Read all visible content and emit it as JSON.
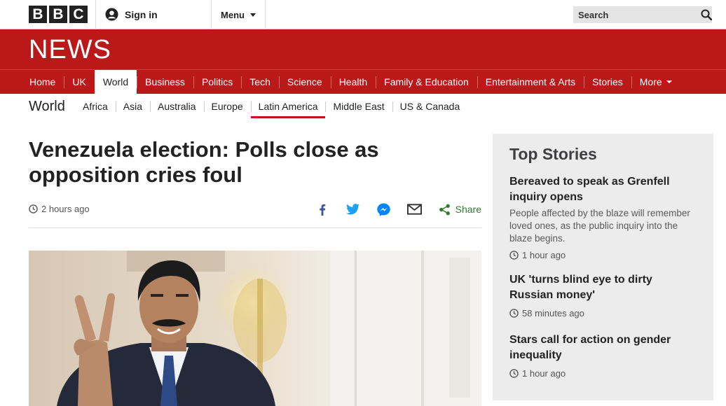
{
  "masthead": {
    "logo_letters": [
      "B",
      "B",
      "C"
    ],
    "signin_label": "Sign in",
    "menu_label": "Menu",
    "search_placeholder": "Search"
  },
  "banner": {
    "title": "NEWS"
  },
  "nav": {
    "items": [
      {
        "label": "Home"
      },
      {
        "label": "UK"
      },
      {
        "label": "World",
        "active": true
      },
      {
        "label": "Business"
      },
      {
        "label": "Politics"
      },
      {
        "label": "Tech"
      },
      {
        "label": "Science"
      },
      {
        "label": "Health"
      },
      {
        "label": "Family & Education"
      },
      {
        "label": "Entertainment & Arts"
      },
      {
        "label": "Stories"
      },
      {
        "label": "More"
      }
    ]
  },
  "subnav": {
    "title": "World",
    "items": [
      {
        "label": "Africa"
      },
      {
        "label": "Asia"
      },
      {
        "label": "Australia"
      },
      {
        "label": "Europe"
      },
      {
        "label": "Latin America",
        "active": true
      },
      {
        "label": "Middle East"
      },
      {
        "label": "US & Canada"
      }
    ]
  },
  "article": {
    "headline": "Venezuela election: Polls close as opposition cries foul",
    "timestamp": "2 hours ago",
    "share_label": "Share",
    "share_icons": [
      "facebook-icon",
      "twitter-icon",
      "messenger-icon",
      "email-icon"
    ]
  },
  "top_stories": {
    "title": "Top Stories",
    "stories": [
      {
        "title": "Bereaved to speak as Grenfell inquiry opens",
        "summary": "People affected by the blaze will remember loved ones, as the public inquiry into the blaze begins.",
        "time": "1 hour ago"
      },
      {
        "title": "UK 'turns blind eye to dirty Russian money'",
        "time": "58 minutes ago"
      },
      {
        "title": "Stars call for action on gender inequality",
        "time": "1 hour ago"
      }
    ]
  },
  "colors": {
    "brand_red": "#bb1919",
    "share_green": "#317b31",
    "facebook": "#3b5998",
    "twitter": "#1da1f2",
    "messenger": "#0084ff"
  }
}
